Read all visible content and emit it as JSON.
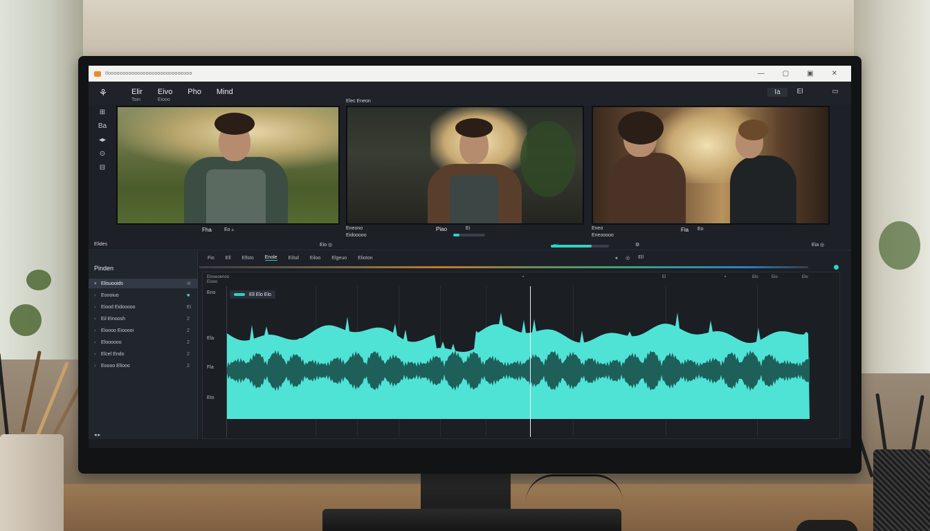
{
  "titlebar": {
    "title": "Ilooooooooooooooooooooooooooooo",
    "controls": [
      "—",
      "▢",
      "▣",
      "✕"
    ]
  },
  "menubar": {
    "items": [
      {
        "label": "Elir",
        "sub": "Toin"
      },
      {
        "label": "Eivo",
        "sub": "Eiooo"
      },
      {
        "label": "Pho",
        "sub": ""
      },
      {
        "label": "Mind",
        "sub": ""
      }
    ],
    "right": [
      "Ia",
      "El",
      "▭"
    ]
  },
  "side_tools": [
    "⊞",
    "Ba",
    "◂▸",
    "⊙",
    "⊟"
  ],
  "previews": {
    "label_top": "Elec Eneon",
    "clip1": {
      "caption": "Fha",
      "icons": "Eo ▵"
    },
    "clip2": {
      "caption_a": "Eneono",
      "caption_b": "Eidooooo",
      "center": "Piao",
      "center_icons": "Ei"
    },
    "clip3": {
      "caption_a": "Eneo",
      "caption_b": "Eneooooo",
      "center": "Fia",
      "center_icons": "Eo"
    },
    "clip3_slider_label": "Elia",
    "left_toggle": "Elides",
    "left_toggle_icons": "Eio ◎",
    "right_toggle_icons": "Eia ◎"
  },
  "left_panel": {
    "header": "Pinden",
    "rows": [
      {
        "label": "Elisuooids",
        "num": "⊘",
        "active": true
      },
      {
        "label": "Eoooiuo",
        "num": "■",
        "highlight": true
      },
      {
        "label": "Eiood Eidooooo",
        "num": "Ei"
      },
      {
        "label": "Eil Einoosh",
        "num": "2"
      },
      {
        "label": "Eioooo Eiooooi",
        "num": "2"
      },
      {
        "label": "Eloooooo",
        "num": "2"
      },
      {
        "label": "Elcel Endo",
        "num": "2"
      },
      {
        "label": "Eoooo Ellooo",
        "num": "2"
      }
    ],
    "footer": "◂ ▸"
  },
  "timeline": {
    "tabs": [
      "Fio",
      "Ell",
      "Ellsto",
      "Enole",
      "Eilsd",
      "Eiloo",
      "Elgeuo",
      "Elioton"
    ],
    "tabs_right": [
      "◂",
      "◎",
      "Ell"
    ],
    "ruler": [
      "Elooeoenoo",
      "Eiooo",
      "•",
      "El",
      "•",
      "Elo",
      "Eio",
      "Elo"
    ],
    "track_labels": [
      "Eno",
      "Ela",
      "Fla",
      "Eto"
    ],
    "clip_label": "Ell Elo Elo"
  },
  "colors": {
    "accent": "#2fd3c6",
    "wave": "#4fe3d6",
    "wave_dark": "#1f5f5a"
  }
}
